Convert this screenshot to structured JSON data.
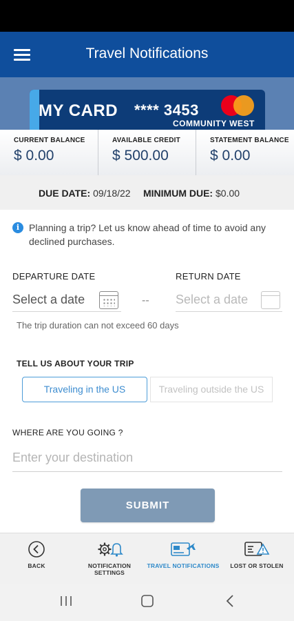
{
  "header": {
    "title": "Travel Notifications",
    "menu_icon": "hamburger-menu-icon"
  },
  "card": {
    "name": "MY CARD",
    "masked_number": "**** 3453",
    "bank": "COMMUNITY WEST",
    "network": "mastercard"
  },
  "balances": [
    {
      "label": "CURRENT BALANCE",
      "value": "$ 0.00"
    },
    {
      "label": "AVAILABLE CREDIT",
      "value": "$ 500.00"
    },
    {
      "label": "STATEMENT BALANCE",
      "value": "$ 0.00"
    }
  ],
  "due": {
    "due_label": "DUE DATE:",
    "due_value": "09/18/22",
    "min_label": "MINIMUM DUE:",
    "min_value": "$0.00"
  },
  "info": {
    "text": "Planning a trip? Let us know ahead of time to avoid any declined purchases."
  },
  "form": {
    "departure_label": "DEPARTURE DATE",
    "departure_placeholder": "Select a date",
    "return_label": "RETURN DATE",
    "return_placeholder": "Select a date",
    "separator": "--",
    "duration_hint": "The trip duration can not exceed 60 days",
    "trip_question": "TELL US ABOUT YOUR TRIP",
    "options": [
      {
        "label": "Traveling in the US",
        "selected": true
      },
      {
        "label": "Traveling outside the US",
        "selected": false
      }
    ],
    "destination_label": "WHERE ARE YOU GOING ?",
    "destination_placeholder": "Enter your destination",
    "submit_label": "SUBMIT"
  },
  "bottom_nav": [
    {
      "label": "BACK",
      "icon": "back-circle-icon"
    },
    {
      "label": "NOTIFICATION SETTINGS",
      "icon": "gear-bell-icon"
    },
    {
      "label": "TRAVEL NOTIFICATIONS",
      "icon": "card-plane-icon",
      "active": true
    },
    {
      "label": "LOST OR STOLEN",
      "icon": "card-warning-icon"
    }
  ],
  "colors": {
    "appbar": "#0f4e9c",
    "accent": "#2e89c9",
    "submit": "#7f9ab5"
  }
}
